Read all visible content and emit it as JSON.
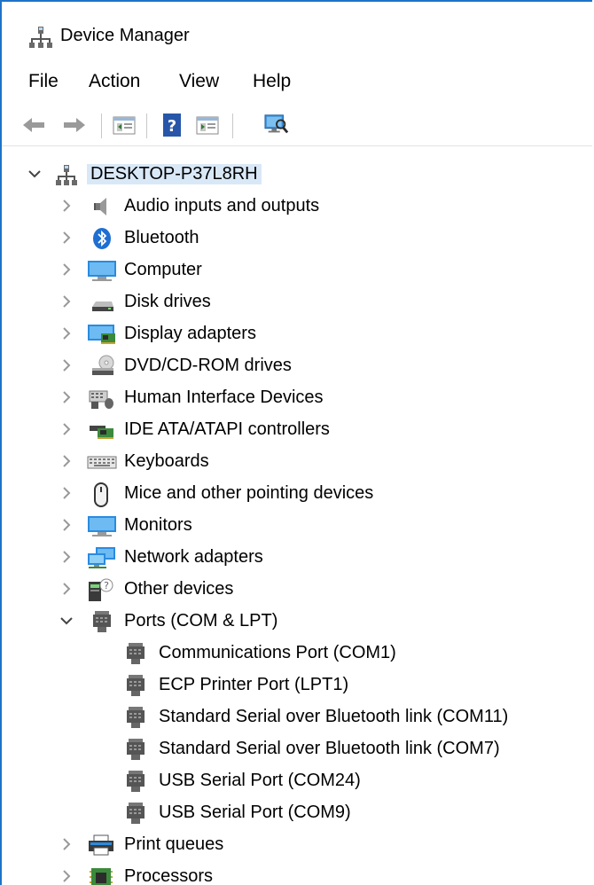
{
  "window": {
    "title": "Device Manager"
  },
  "menu": {
    "file": "File",
    "action": "Action",
    "view": "View",
    "help": "Help"
  },
  "toolbar": {
    "back_icon": "back-arrow-icon",
    "forward_icon": "forward-arrow-icon",
    "properties_icon": "properties-icon",
    "help_icon": "help-icon",
    "update_driver_icon": "update-driver-icon",
    "scan_icon": "scan-hardware-icon"
  },
  "tree": {
    "root": {
      "label": "DESKTOP-P37L8RH",
      "expanded": true
    },
    "categories": [
      {
        "label": "Audio inputs and outputs",
        "icon": "speaker-icon"
      },
      {
        "label": "Bluetooth",
        "icon": "bluetooth-icon"
      },
      {
        "label": "Computer",
        "icon": "computer-icon"
      },
      {
        "label": "Disk drives",
        "icon": "disk-drive-icon"
      },
      {
        "label": "Display adapters",
        "icon": "display-adapter-icon"
      },
      {
        "label": "DVD/CD-ROM drives",
        "icon": "dvd-drive-icon"
      },
      {
        "label": "Human Interface Devices",
        "icon": "hid-icon"
      },
      {
        "label": "IDE ATA/ATAPI controllers",
        "icon": "ide-controller-icon"
      },
      {
        "label": "Keyboards",
        "icon": "keyboard-icon"
      },
      {
        "label": "Mice and other pointing devices",
        "icon": "mouse-icon"
      },
      {
        "label": "Monitors",
        "icon": "monitor-icon"
      },
      {
        "label": "Network adapters",
        "icon": "network-adapter-icon"
      },
      {
        "label": "Other devices",
        "icon": "unknown-device-icon"
      },
      {
        "label": "Ports (COM & LPT)",
        "icon": "port-icon",
        "expanded": true
      }
    ],
    "ports": [
      {
        "label": "Communications Port (COM1)"
      },
      {
        "label": "ECP Printer Port (LPT1)"
      },
      {
        "label": "Standard Serial over Bluetooth link (COM11)"
      },
      {
        "label": "Standard Serial over Bluetooth link (COM7)"
      },
      {
        "label": "USB Serial Port (COM24)"
      },
      {
        "label": "USB Serial Port (COM9)"
      }
    ],
    "after": [
      {
        "label": "Print queues",
        "icon": "printer-icon"
      },
      {
        "label": "Processors",
        "icon": "processor-icon"
      }
    ]
  }
}
